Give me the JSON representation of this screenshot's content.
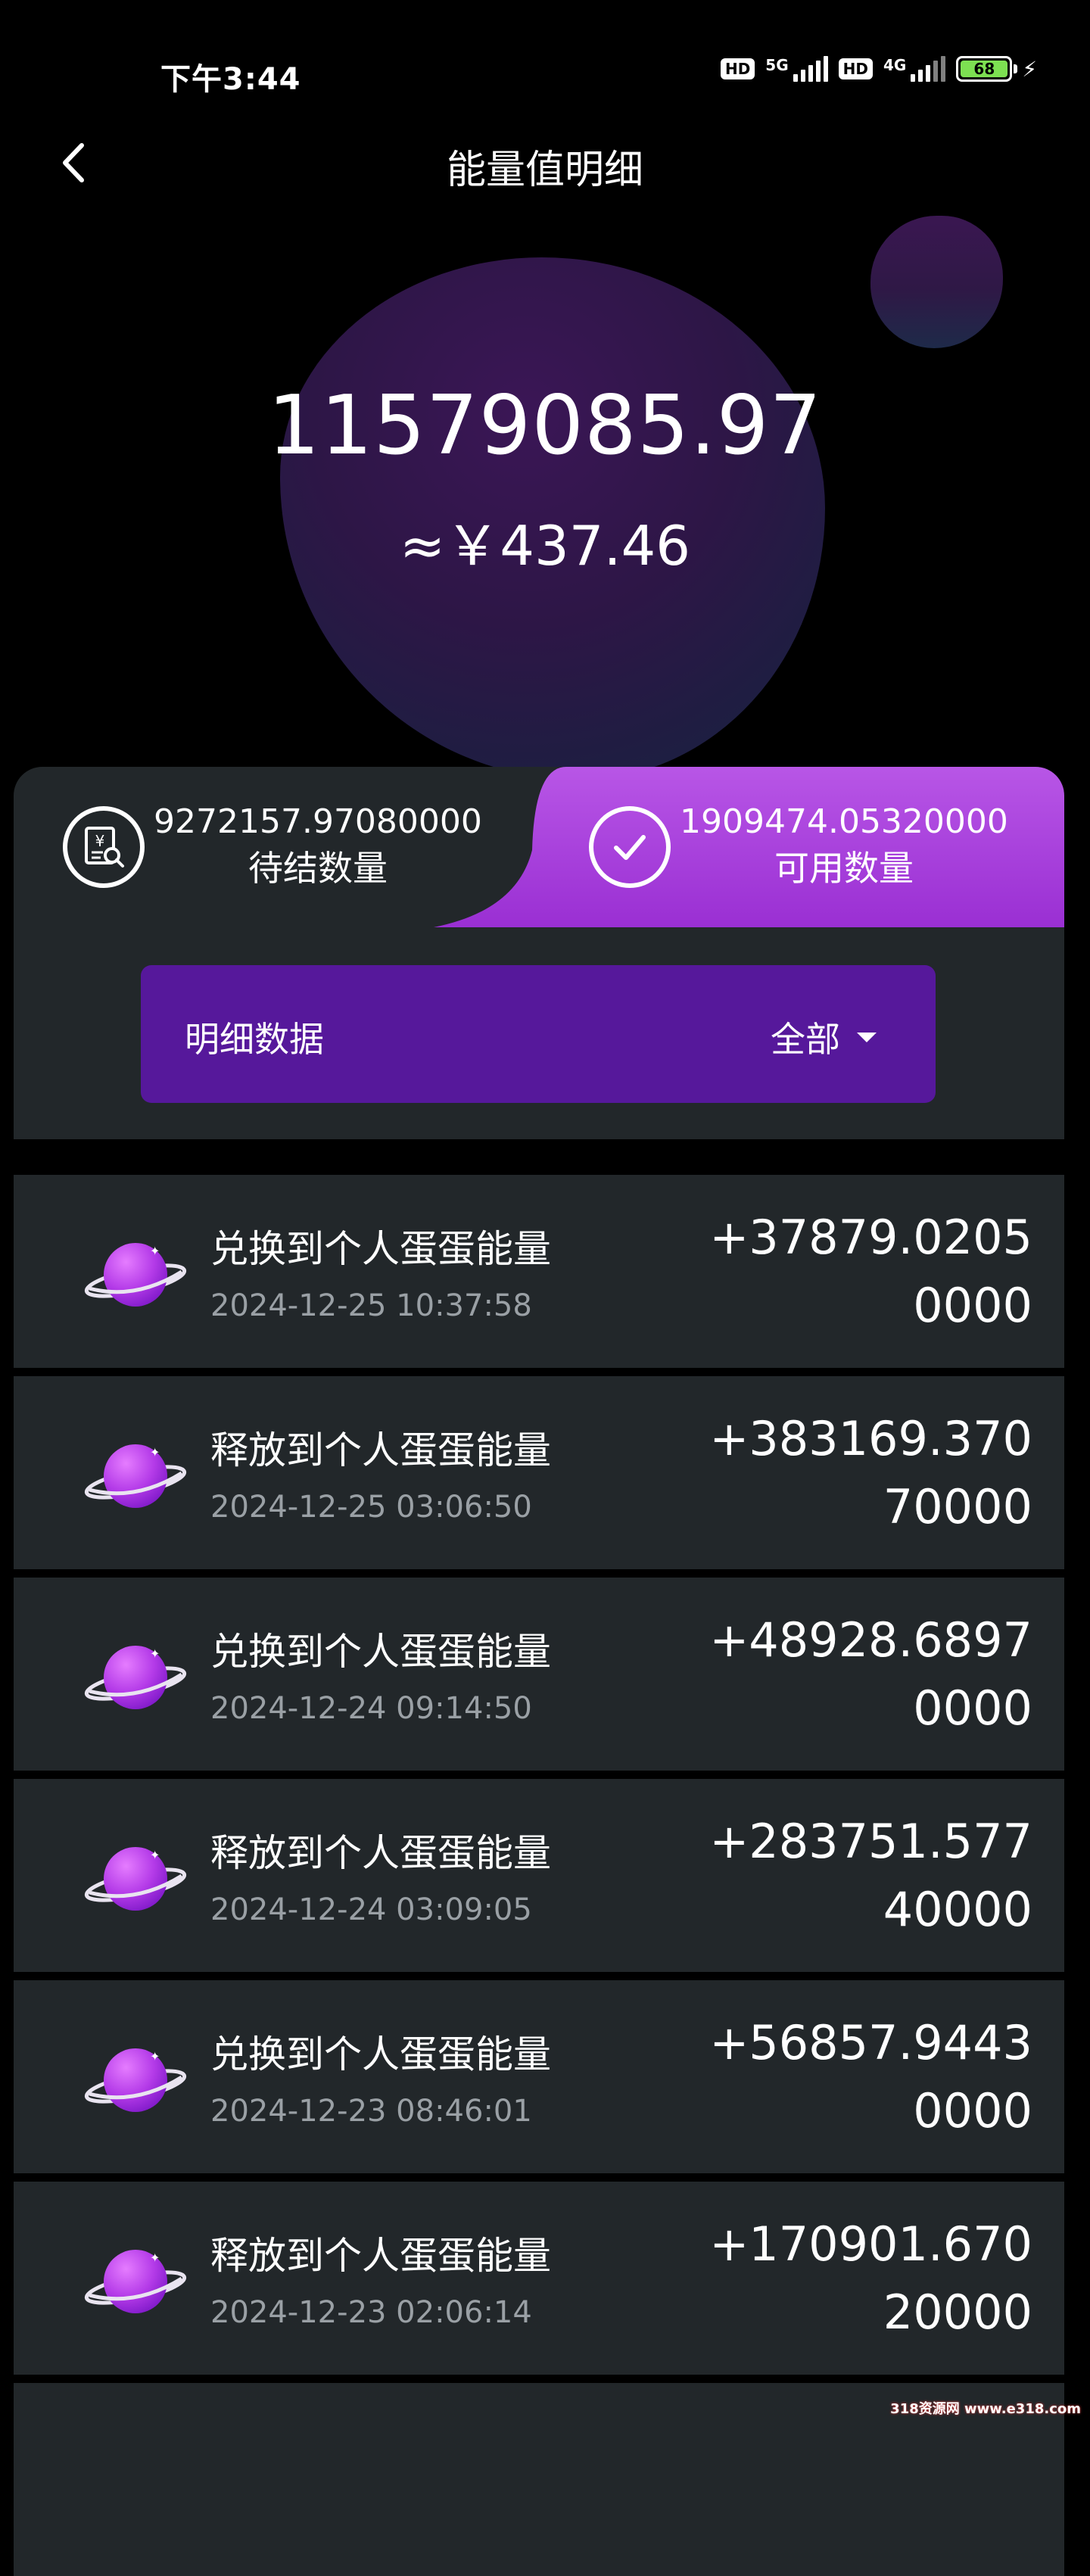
{
  "status_bar": {
    "time": "下午3:44",
    "hd1": "HD",
    "net1": "5G",
    "hd2": "HD",
    "net2": "4G",
    "battery_level": "68",
    "battery_color": "#7de052"
  },
  "header": {
    "back_icon": "chevron-left-icon",
    "title": "能量值明细"
  },
  "summary": {
    "total_energy": "11579085.97",
    "rmb_equivalent": "≈￥437.46"
  },
  "stats": {
    "pending": {
      "value": "9272157.97080000",
      "label": "待结数量",
      "icon": "receipt-search-icon"
    },
    "available": {
      "value": "1909474.05320000",
      "label": "可用数量",
      "icon": "check-circle-icon"
    },
    "active_color": "#b24ee3"
  },
  "filter": {
    "title": "明细数据",
    "selected": "全部",
    "bg_color": "#56189b"
  },
  "records": [
    {
      "title": "兑换到个人蛋蛋能量",
      "time": "2024-12-25 10:37:58",
      "amount": "+37879.02050000"
    },
    {
      "title": "释放到个人蛋蛋能量",
      "time": "2024-12-25 03:06:50",
      "amount": "+383169.37070000"
    },
    {
      "title": "兑换到个人蛋蛋能量",
      "time": "2024-12-24 09:14:50",
      "amount": "+48928.68970000"
    },
    {
      "title": "释放到个人蛋蛋能量",
      "time": "2024-12-24 03:09:05",
      "amount": "+283751.57740000"
    },
    {
      "title": "兑换到个人蛋蛋能量",
      "time": "2024-12-23 08:46:01",
      "amount": "+56857.94430000"
    },
    {
      "title": "释放到个人蛋蛋能量",
      "time": "2024-12-23 02:06:14",
      "amount": "+170901.67020000"
    }
  ],
  "record_icon": "planet-icon",
  "watermark": "318资源网 www.e318.com"
}
